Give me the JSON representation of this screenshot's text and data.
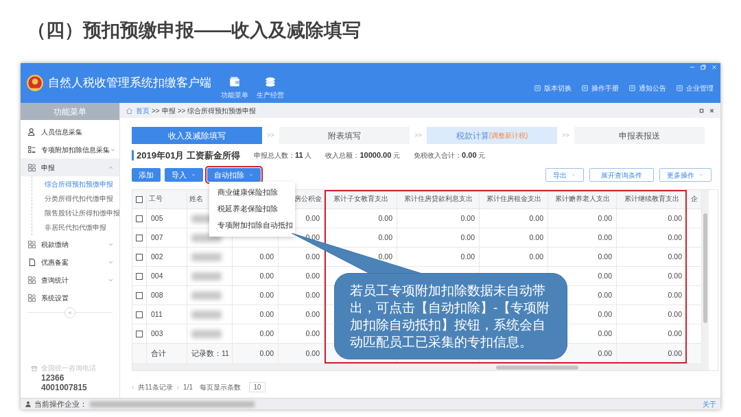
{
  "slide_title": "（四）预扣预缴申报——收入及减除填写",
  "app": {
    "title": "自然人税收管理系统扣缴客户端",
    "toolbar": [
      {
        "label": "功能菜单"
      },
      {
        "label": "生产经营"
      }
    ],
    "header_links": [
      {
        "label": "版本切换"
      },
      {
        "label": "操作手册"
      },
      {
        "label": "通知公告"
      },
      {
        "label": "企业管理"
      }
    ]
  },
  "sidebar": {
    "heading": "功能菜单",
    "items": [
      {
        "label": "人员信息采集",
        "expandable": false,
        "expanded": false
      },
      {
        "label": "专项附加扣除信息采集",
        "expandable": true,
        "expanded": false
      },
      {
        "label": "申报",
        "expandable": true,
        "expanded": true,
        "children": [
          {
            "label": "综合所得预扣预缴申报",
            "selected": true
          },
          {
            "label": "分类所得代扣代缴申报",
            "selected": false
          },
          {
            "label": "限售股转让所得扣缴申报",
            "selected": false
          },
          {
            "label": "非居民代扣代缴申报",
            "selected": false
          }
        ]
      },
      {
        "label": "税款缴纳",
        "expandable": true,
        "expanded": false
      },
      {
        "label": "优惠备案",
        "expandable": true,
        "expanded": false
      },
      {
        "label": "查询统计",
        "expandable": true,
        "expanded": false
      },
      {
        "label": "系统设置",
        "expandable": false,
        "expanded": false
      }
    ],
    "collapse": "«",
    "hotline_label": "全国统一咨询电话",
    "phones": [
      "12366",
      "4001007815"
    ]
  },
  "breadcrumb": {
    "items": [
      "首页",
      "申报",
      "综合所得预扣预缴申报"
    ],
    "separator": ">>"
  },
  "steps": [
    {
      "label": "收入及减除填写",
      "selected": true,
      "highlighted": false
    },
    {
      "label": "附表填写",
      "selected": false,
      "highlighted": false
    },
    {
      "label": "税款计算",
      "note": "(调整新计税)",
      "selected": false,
      "highlighted": true
    },
    {
      "label": "申报表报送",
      "selected": false,
      "highlighted": false
    }
  ],
  "step_separator": ">>",
  "period": "2019年01月 工资薪金所得",
  "summary": [
    {
      "label": "申报总人数：",
      "value": "11",
      "unit": "人"
    },
    {
      "label": "收入总额：",
      "value": "10000.00",
      "unit": "元"
    },
    {
      "label": "免税收入合计：",
      "value": "0.00",
      "unit": "元"
    }
  ],
  "left_buttons": [
    {
      "label": "添加",
      "dropdown": false,
      "highlighted": false
    },
    {
      "label": "导入",
      "dropdown": true,
      "highlighted": false
    },
    {
      "label": "自动扣除",
      "dropdown": true,
      "highlighted": true
    }
  ],
  "right_buttons": [
    {
      "label": "导出",
      "dropdown": true
    },
    {
      "label": "展开查询条件",
      "dropdown": false
    },
    {
      "label": "更多操作",
      "dropdown": true
    }
  ],
  "dropdown_menu": [
    "商业健康保险扣除",
    "税延养老保险扣除",
    "专项附加扣除自动抵扣"
  ],
  "table": {
    "select_all_checked": false,
    "columns": [
      {
        "label": "工号",
        "kind": "text",
        "highlighted": false
      },
      {
        "label": "姓名",
        "kind": "redacted",
        "highlighted": false
      },
      {
        "kind": "number",
        "highlighted": false
      },
      {
        "label": "房公积金",
        "kind": "number",
        "highlighted": false
      },
      {
        "label": "累计子女教育支出",
        "kind": "number",
        "highlighted": true
      },
      {
        "label": "累计住房贷款利息支出",
        "kind": "number",
        "highlighted": true
      },
      {
        "label": "累计住房租金支出",
        "kind": "number",
        "highlighted": true
      },
      {
        "label": "累计赡养老人支出",
        "kind": "number",
        "highlighted": true
      },
      {
        "label": "累计继续教育支出",
        "kind": "number",
        "highlighted": true
      },
      {
        "label": "企",
        "kind": "number",
        "highlighted": false
      }
    ],
    "rows": [
      {
        "checked": false,
        "id": "005",
        "housing_fund": "0.00",
        "child_education": "0.00",
        "mortgage_interest": "0.00",
        "rent": "0.00",
        "elderly_support": "0.00",
        "continuing_education": "0.00"
      },
      {
        "checked": false,
        "id": "007",
        "housing_fund": "0.00",
        "child_education": "0.00",
        "mortgage_interest": "0.00",
        "rent": "0.00",
        "elderly_support": "0.00",
        "continuing_education": "0.00"
      },
      {
        "checked": false,
        "id": "002",
        "column_3": "0.00",
        "housing_fund": "0.00",
        "child_education": "0.00",
        "mortgage_interest": "0.00",
        "rent": "0.00",
        "elderly_support": "0.00",
        "continuing_education": "0.00"
      },
      {
        "checked": false,
        "id": "004",
        "column_3": "0.00",
        "housing_fund": "0.00",
        "elderly_support": "0.00",
        "continuing_education": "0.00"
      },
      {
        "checked": false,
        "id": "008",
        "column_3": "0.00",
        "housing_fund": "0.00",
        "elderly_support": "0.00",
        "continuing_education": "0.00"
      },
      {
        "checked": false,
        "id": "011",
        "column_3": "0.00",
        "housing_fund": "0.00",
        "elderly_support": "0.00",
        "continuing_education": "0.00"
      },
      {
        "checked": false,
        "id": "003",
        "column_3": "0.00",
        "housing_fund": "0.00",
        "elderly_support": "0.00",
        "continuing_education": "0.00"
      }
    ],
    "total_row": {
      "id": "合计",
      "name": "记录数：11",
      "column_3": "0.00",
      "housing_fund": "0.00",
      "elderly_support": "0.00",
      "continuing_education": "0.00"
    }
  },
  "pagination": {
    "prev": "‹",
    "summary": "共11条记录",
    "next": "›",
    "page": "1/1",
    "page_size_label": "每页显示条数",
    "page_size": "10"
  },
  "status_bar": {
    "label": "当前操作企业：",
    "about": "关于"
  },
  "callout": "若员工专项附加扣除数据未自动带出，可点击【自动扣除】-【专项附加扣除自动抵扣】按钮，系统会自动匹配员工已采集的专扣信息。"
}
